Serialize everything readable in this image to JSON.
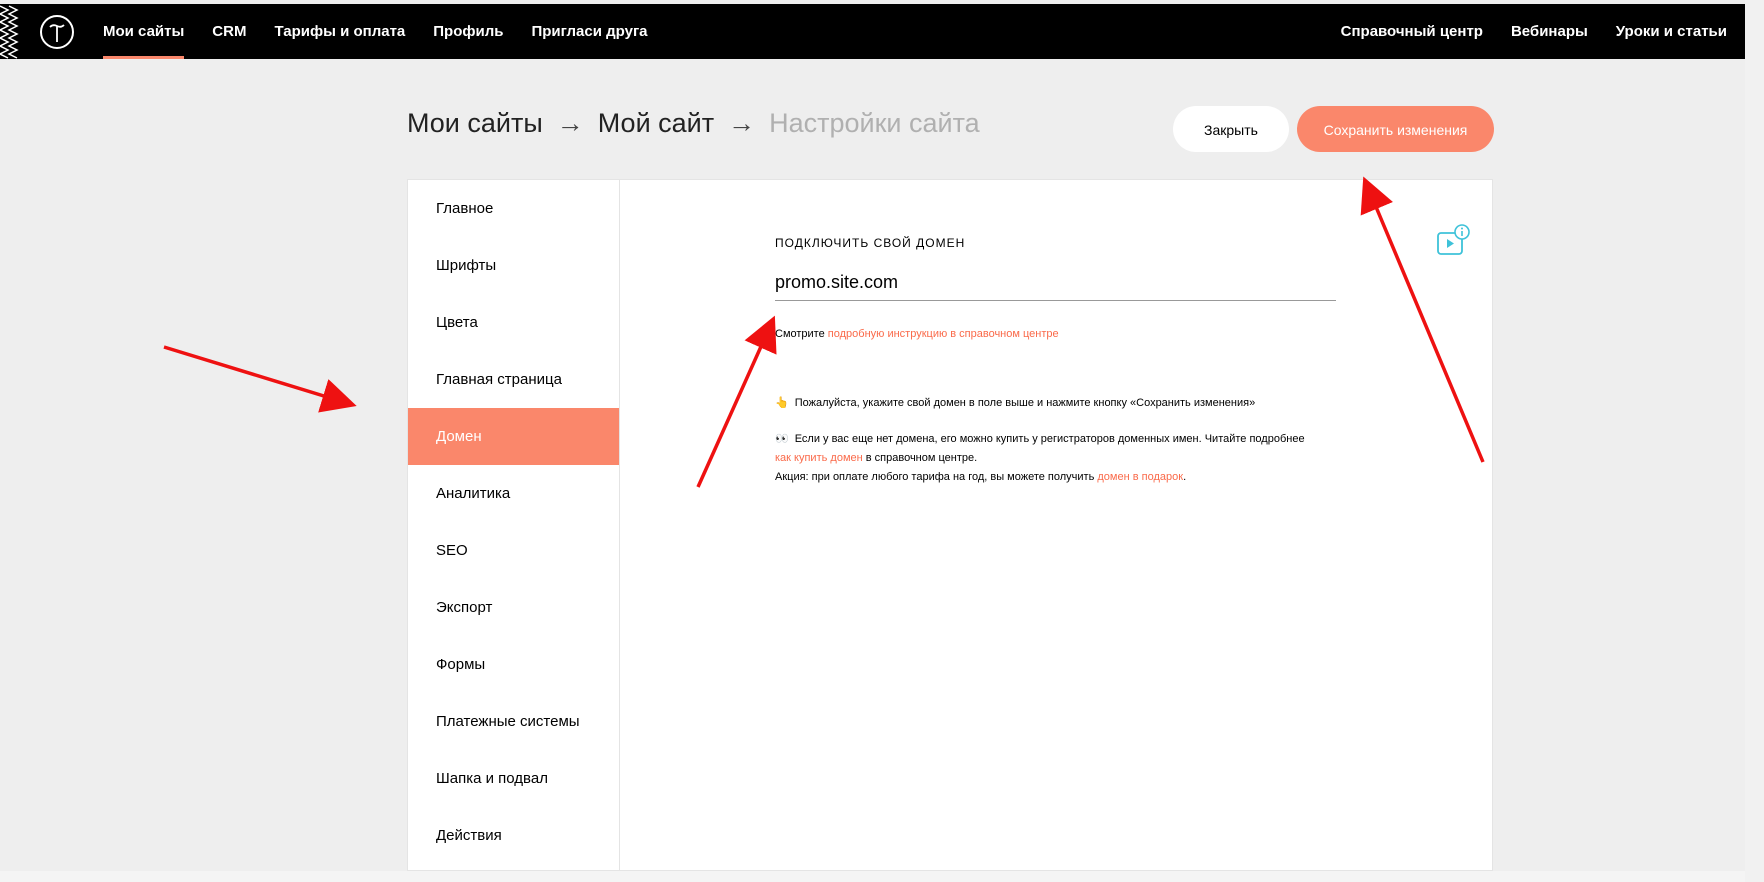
{
  "nav": {
    "left": [
      {
        "label": "Мои сайты",
        "active": true
      },
      {
        "label": "CRM"
      },
      {
        "label": "Тарифы и оплата"
      },
      {
        "label": "Профиль"
      },
      {
        "label": "Пригласи друга"
      }
    ],
    "right": [
      {
        "label": "Справочный центр"
      },
      {
        "label": "Вебинары"
      },
      {
        "label": "Уроки и статьи"
      }
    ]
  },
  "breadcrumb": {
    "items": [
      "Мои сайты",
      "Мой сайт",
      "Настройки сайта"
    ],
    "separator": "→"
  },
  "buttons": {
    "close": "Закрыть",
    "save": "Сохранить изменения"
  },
  "sidebar": {
    "items": [
      {
        "label": "Главное"
      },
      {
        "label": "Шрифты"
      },
      {
        "label": "Цвета"
      },
      {
        "label": "Главная страница"
      },
      {
        "label": "Домен",
        "active": true
      },
      {
        "label": "Аналитика"
      },
      {
        "label": "SEO"
      },
      {
        "label": "Экспорт"
      },
      {
        "label": "Формы"
      },
      {
        "label": "Платежные системы"
      },
      {
        "label": "Шапка и подвал"
      },
      {
        "label": "Действия"
      }
    ]
  },
  "domain": {
    "section_title": "ПОДКЛЮЧИТЬ СВОЙ ДОМЕН",
    "value": "promo.site.com",
    "help_prefix": "Смотрите",
    "help_link": "подробную инструкцию в справочном центре",
    "note1": "Пожалуйста, укажите свой домен в поле выше и нажмите кнопку «Сохранить изменения»",
    "note2_text": "Если у вас еще нет домена, его можно купить у регистраторов доменных имен. Читайте подробнее",
    "note2_link": "как купить домен",
    "note2_suffix": "в справочном центре.",
    "note3_text": "Акция: при оплате любого тарифа на год, вы можете получить",
    "note3_link": "домен в подарок",
    "note3_suffix": "."
  },
  "colors": {
    "accent": "#fa876b",
    "nav_bg": "#000000",
    "page_bg": "#eeeeee",
    "arrow": "#ee1111",
    "info_icon": "#3ec2d9"
  },
  "icons": [
    "tilda-logo-icon",
    "video-help-icon",
    "pointing-hand-icon",
    "eyes-icon"
  ]
}
